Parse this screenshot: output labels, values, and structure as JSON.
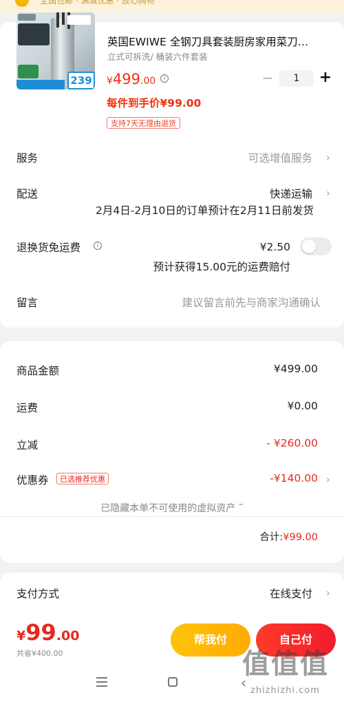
{
  "banner": {
    "text": "全国包邮 · 满减优惠 · 放心购物"
  },
  "product": {
    "title": "英国EWIWE 全钢刀具套装厨房家用菜刀…",
    "spec": "立式可拆洗/ 桶装六件套装",
    "price_symbol": "¥",
    "price_int": "499",
    "price_dec": ".00",
    "quantity": "1",
    "hand_price": "每件到手价¥99.00",
    "return_policy": "支持7天无理由退货",
    "thumbnail_price": "239"
  },
  "order": {
    "service_label": "服务",
    "service_value": "可选增值服务",
    "delivery_label": "配送",
    "delivery_value": "快递运输",
    "delivery_note": "2月4日-2月10日的订单预计在2月11日前发货",
    "return_fee_label": "退换货免运费",
    "return_fee_value": "¥2.50",
    "return_fee_note": "预计获得15.00元的运费赔付",
    "message_label": "留言",
    "message_placeholder": "建议留言前先与商家沟通确认"
  },
  "summary": {
    "goods_amount_label": "商品金额",
    "goods_amount_value": "¥499.00",
    "shipping_label": "运费",
    "shipping_value": "¥0.00",
    "discount_label": "立减",
    "discount_value": "- ¥260.00",
    "coupon_label": "优惠券",
    "coupon_badge": "已选推荐优惠",
    "coupon_value": "-¥140.00",
    "hidden_assets": "已隐藏本单不可使用的虚拟资产 ˜",
    "total_label": "合计:",
    "total_value": "¥99.00"
  },
  "payment": {
    "method_label": "支付方式",
    "method_value": "在线支付"
  },
  "checkout": {
    "price_symbol": "¥",
    "price_int": "99",
    "price_dec": ".00",
    "saved": "共省¥400.00",
    "help_pay": "帮我付",
    "self_pay": "自己付"
  },
  "watermark": {
    "main": "值值值",
    "sub": "zhizhizhi.com"
  },
  "icons": [
    "info-icon",
    "chevron-right-icon",
    "minus-icon",
    "plus-icon",
    "menu-icon",
    "home-icon",
    "back-icon"
  ],
  "colors": {
    "accent": "#e8281e",
    "help_button": "#ffb300",
    "pay_button": "#f21c2c"
  }
}
